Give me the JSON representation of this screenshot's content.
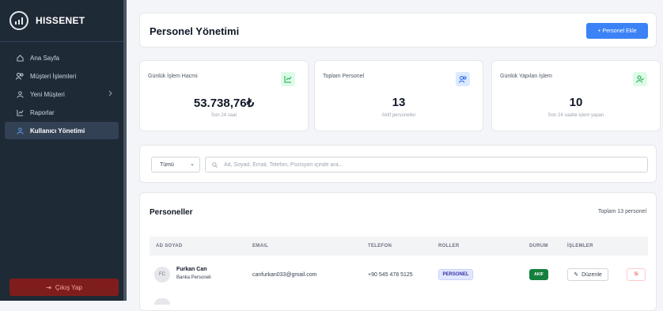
{
  "brand": {
    "name": "HISSENET"
  },
  "sidebar": {
    "items": [
      {
        "label": "Ana Sayfa",
        "icon": "home-icon"
      },
      {
        "label": "Müşteri İşlemleri",
        "icon": "users-icon"
      },
      {
        "label": "Yeni Müşteri",
        "icon": "user-add-icon"
      },
      {
        "label": "Raporlar",
        "icon": "chart-icon"
      },
      {
        "label": "Kullanıcı Yönetimi",
        "icon": "user-manage-icon"
      }
    ],
    "logout_label": "Çıkış Yap"
  },
  "header": {
    "title": "Personel Yönetimi",
    "add_button": "+ Personel Ekle"
  },
  "stats": [
    {
      "label": "Günlük İşlem Hacmi",
      "value": "53.738,76₺",
      "sub": "Son 24 saat",
      "icon": "trend-icon",
      "color": "#dcfce7"
    },
    {
      "label": "Toplam Personel",
      "value": "13",
      "sub": "Aktif personeller",
      "icon": "users-icon",
      "color": "#dbeafe"
    },
    {
      "label": "Günlük Yapılan İşlem",
      "value": "10",
      "sub": "Son 24 saatte işlem yapan",
      "icon": "user-check-icon",
      "color": "#dcfce7"
    }
  ],
  "filter": {
    "select_value": "Tümü",
    "search_placeholder": "Ad, Soyad, Email, Telefon, Pozisyon içinde ara..."
  },
  "list": {
    "title": "Personeller",
    "total": "Toplam 13 personel",
    "columns": [
      "AD SOYAD",
      "EMAIL",
      "TELEFON",
      "ROLLER",
      "DURUM",
      "İŞLEMLER"
    ],
    "rows": [
      {
        "initials": "FC",
        "name": "Furkan Can",
        "role_line": "Banka Personeli",
        "email": "canfurkan033@gmail.com",
        "phone": "+90 545 478 5125",
        "role": "PERSONEL",
        "status": "AKIF",
        "edit": "Düzenle",
        "delete": "Si"
      }
    ]
  },
  "colors": {
    "primary": "#3b82f6",
    "sidebar": "#1f2a37",
    "success": "#15803d",
    "danger": "#dc2626"
  }
}
